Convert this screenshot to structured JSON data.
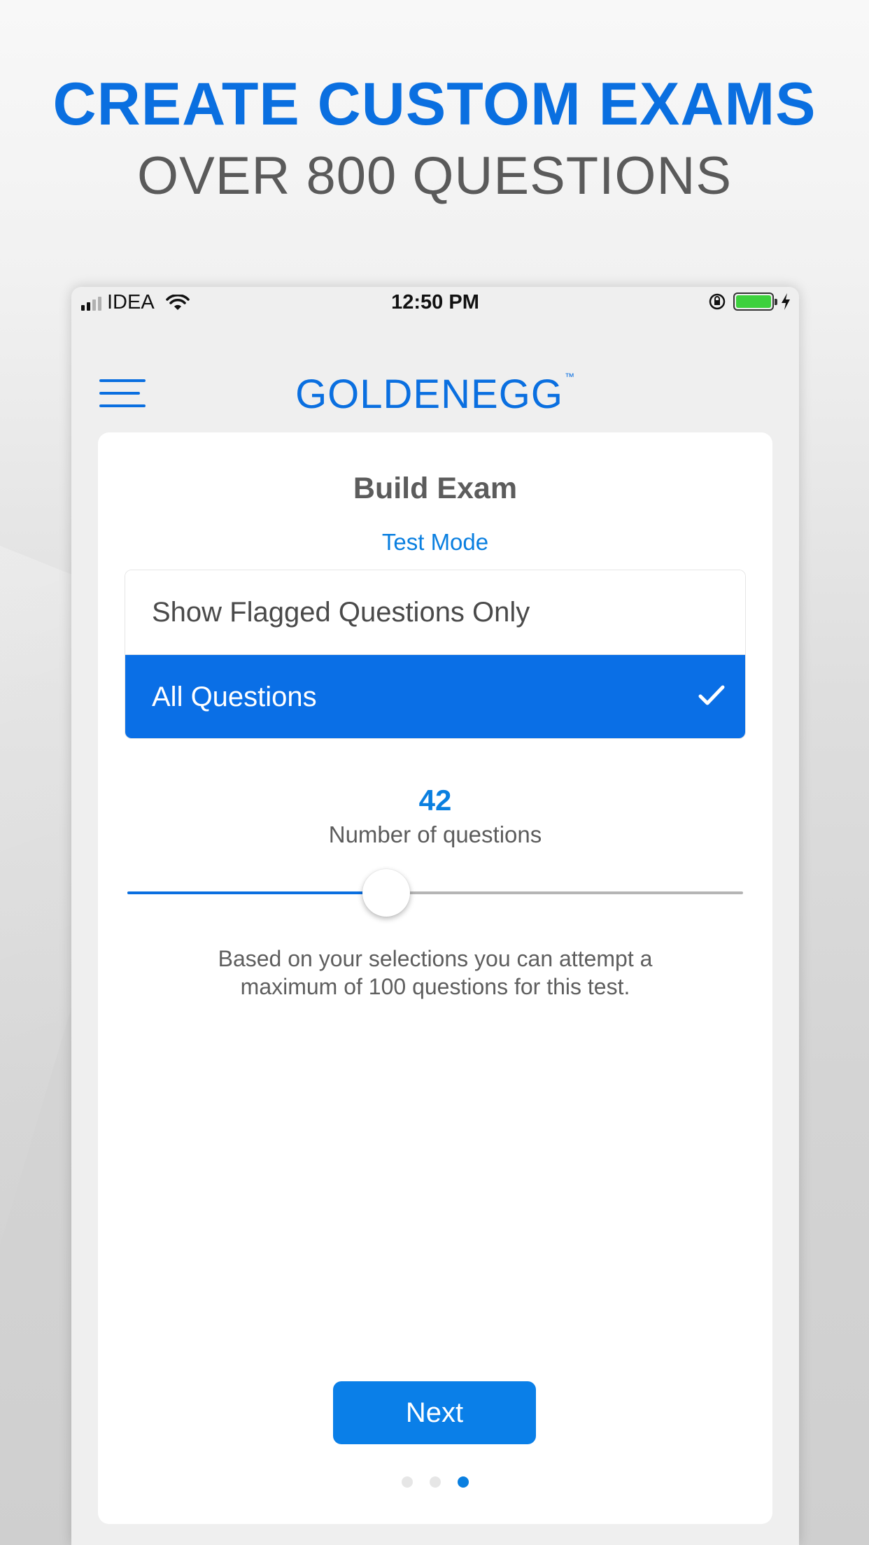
{
  "headline": {
    "line1": "CREATE CUSTOM EXAMS",
    "line2": "OVER 800 QUESTIONS"
  },
  "status_bar": {
    "carrier": "IDEA",
    "time": "12:50 PM",
    "battery_level": 1.0
  },
  "navbar": {
    "logo_bold": "GOLDEN",
    "logo_light": "EGG",
    "logo_tm": "™"
  },
  "card": {
    "title": "Build Exam",
    "subtitle": "Test Mode",
    "options": [
      {
        "label": "Show Flagged Questions Only",
        "selected": false
      },
      {
        "label": "All Questions",
        "selected": true
      }
    ],
    "question_count": "42",
    "question_count_label": "Number of questions",
    "slider_fraction": 0.42,
    "info_text": "Based on your selections you can attempt a maximum of 100 questions for this test.",
    "next_label": "Next"
  },
  "pager": {
    "total": 3,
    "active_index": 2
  },
  "colors": {
    "accent": "#0a6fe0",
    "selected_row": "#0a6fe6",
    "heading_gray": "#5a5a5a",
    "battery_green": "#3dd13d"
  },
  "icons": [
    "signal-icon",
    "wifi-icon",
    "rotation-lock-icon",
    "battery-icon",
    "charging-icon",
    "menu-icon",
    "checkmark-icon"
  ]
}
